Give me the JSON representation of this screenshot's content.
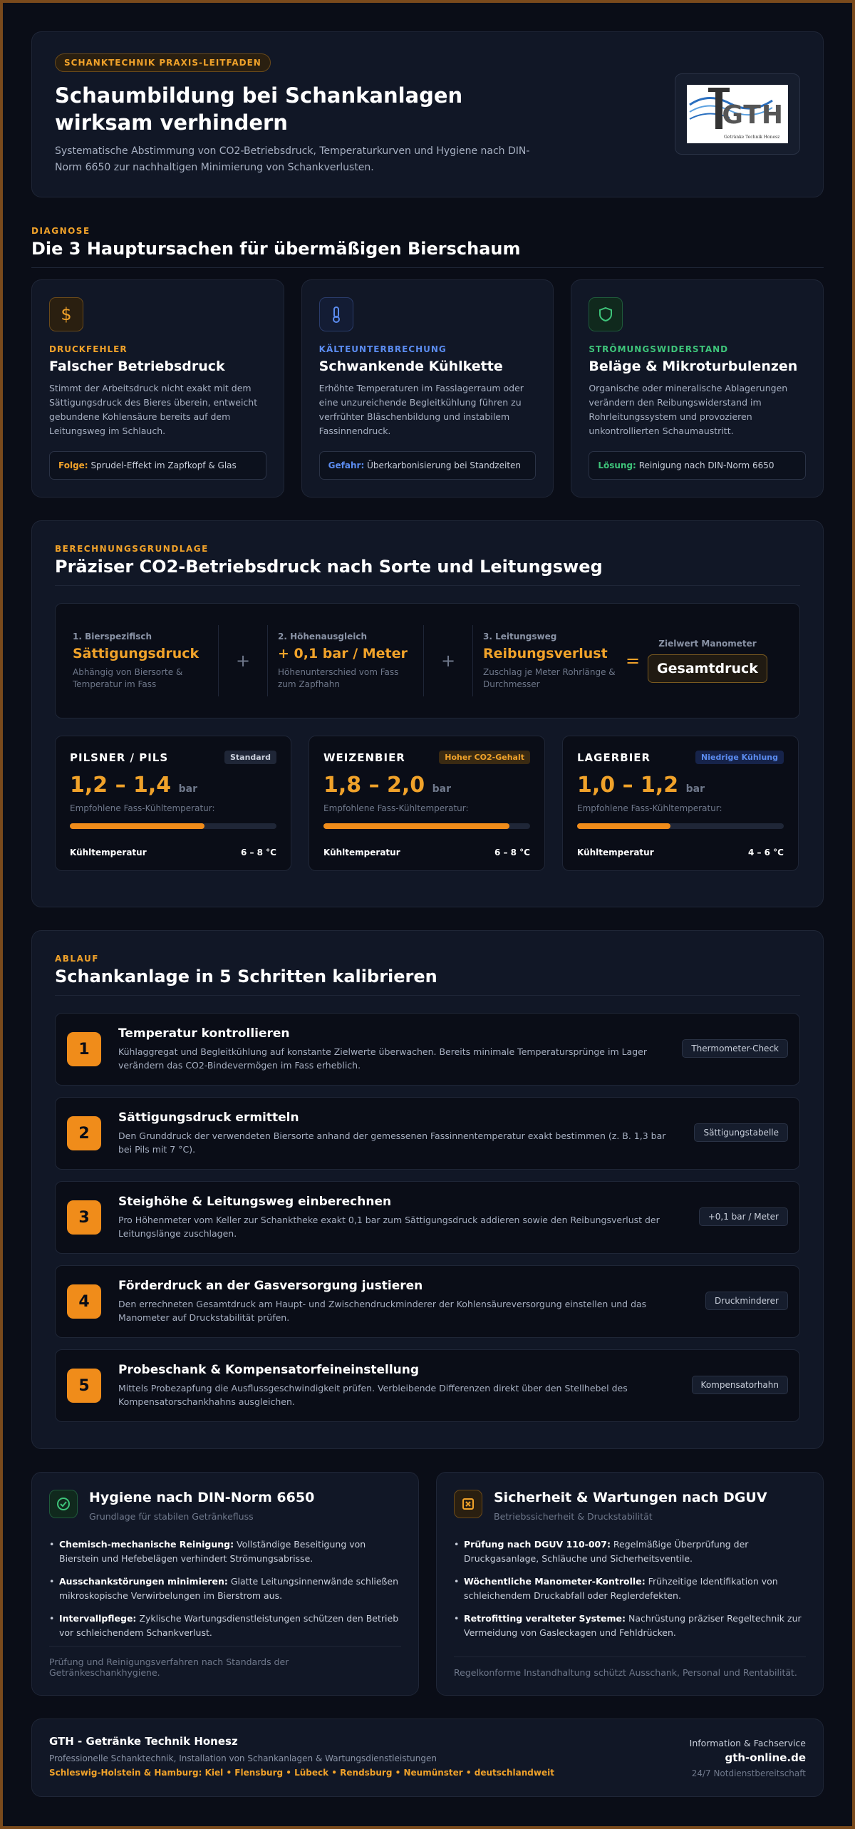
{
  "hero": {
    "pill": "SCHANKTECHNIK PRAXIS-LEITFADEN",
    "title": "Schaumbildung bei Schankanlagen wirksam verhindern",
    "desc": "Systematische Abstimmung von CO2-Betriebsdruck, Temperaturkurven und Hygiene nach DIN-Norm 6650 zur nachhaltigen Minimierung von Schankverlusten.",
    "logo_text": "GTH",
    "logo_sub": "Getränke Technik Honesz"
  },
  "diagnose": {
    "eyebrow": "DIAGNOSE",
    "title": "Die 3 Hauptursachen für übermäßigen Bierschaum",
    "cards": [
      {
        "tag": "DRUCKFEHLER",
        "title": "Falscher Betriebsdruck",
        "text": "Stimmt der Arbeitsdruck nicht exakt mit dem Sättigungsdruck des Bieres überein, entweicht gebundene Kohlensäure bereits auf dem Leitungsweg im Schlauch.",
        "note_key": "Folge:",
        "note": "Sprudel-Effekt im Zapfkopf & Glas",
        "color": "#f0a22a",
        "icon": "dollar-icon"
      },
      {
        "tag": "KÄLTEUNTERBRECHUNG",
        "title": "Schwankende Kühlkette",
        "text": "Erhöhte Temperaturen im Fasslagerraum oder eine unzureichende Begleitkühlung führen zu verfrühter Bläschenbildung und instabilem Fassinnendruck.",
        "note_key": "Gefahr:",
        "note": "Überkarbonisierung bei Standzeiten",
        "color": "#5b8cf0",
        "icon": "thermometer-icon"
      },
      {
        "tag": "STRÖMUNGSWIDERSTAND",
        "title": "Beläge & Mikroturbulenzen",
        "text": "Organische oder mineralische Ablagerungen verändern den Reibungswiderstand im Rohrleitungssystem und provozieren unkontrollierten Schaumaustritt.",
        "note_key": "Lösung:",
        "note": "Reinigung nach DIN-Norm 6650",
        "color": "#3ec47a",
        "icon": "shield-icon"
      }
    ]
  },
  "calc": {
    "eyebrow": "BERECHNUNGSGRUNDLAGE",
    "title": "Präziser CO2-Betriebsdruck nach Sorte und Leitungsweg",
    "parts": [
      {
        "n": "1. Bierspezifisch",
        "v": "Sättigungsdruck",
        "d": "Abhängig von Biersorte & Temperatur im Fass"
      },
      {
        "n": "2. Höhenausgleich",
        "v": "+ 0,1 bar / Meter",
        "d": "Höhenunterschied vom Fass zum Zapfhahn"
      },
      {
        "n": "3. Leitungsweg",
        "v": "Reibungsverlust",
        "d": "Zuschlag je Meter Rohrlänge & Durchmesser"
      }
    ],
    "op_plus": "+",
    "op_eq": "=",
    "result_label": "Zielwert Manometer",
    "result": "Gesamtdruck",
    "beers": [
      {
        "name": "PILSNER / PILS",
        "badge": "Standard",
        "badge_fg": "#c9cfdb",
        "badge_bg": "#1f2637",
        "value": "1,2 – 1,4",
        "unit": "bar",
        "label": "Empfohlene Fass-Kühltemperatur:",
        "fill": 0.65,
        "foot_l": "Kühltemperatur",
        "foot_r": "6 – 8 °C"
      },
      {
        "name": "WEIZENBIER",
        "badge": "Hoher CO2-Gehalt",
        "badge_fg": "#f0a22a",
        "badge_bg": "#3a2a12",
        "value": "1,8 – 2,0",
        "unit": "bar",
        "label": "Empfohlene Fass-Kühltemperatur:",
        "fill": 0.9,
        "foot_l": "Kühltemperatur",
        "foot_r": "6 – 8 °C"
      },
      {
        "name": "LAGERBIER",
        "badge": "Niedrige Kühlung",
        "badge_fg": "#5b8cf0",
        "badge_bg": "#16234a",
        "value": "1,0 – 1,2",
        "unit": "bar",
        "label": "Empfohlene Fass-Kühltemperatur:",
        "fill": 0.45,
        "foot_l": "Kühltemperatur",
        "foot_r": "4 – 6 °C"
      }
    ]
  },
  "steps": {
    "eyebrow": "ABLAUF",
    "title": "Schankanlage in 5 Schritten kalibrieren",
    "items": [
      {
        "n": "1",
        "t": "Temperatur kontrollieren",
        "d": "Kühlaggregat und Begleitkühlung auf konstante Zielwerte überwachen. Bereits minimale Temperatursprünge im Lager verändern das CO2-Bindevermögen im Fass erheblich.",
        "chip": "Thermometer-Check"
      },
      {
        "n": "2",
        "t": "Sättigungsdruck ermitteln",
        "d": "Den Grunddruck der verwendeten Biersorte anhand der gemessenen Fassinnentemperatur exakt bestimmen (z. B. 1,3 bar bei Pils mit 7 °C).",
        "chip": "Sättigungstabelle"
      },
      {
        "n": "3",
        "t": "Steighöhe & Leitungsweg einberechnen",
        "d": "Pro Höhenmeter vom Keller zur Schanktheke exakt 0,1 bar zum Sättigungsdruck addieren sowie den Reibungsverlust der Leitungslänge zuschlagen.",
        "chip": "+0,1 bar / Meter"
      },
      {
        "n": "4",
        "t": "Förderdruck an der Gasversorgung justieren",
        "d": "Den errechneten Gesamtdruck am Haupt- und Zwischendruckminderer der Kohlensäureversorgung einstellen und das Manometer auf Druckstabilität prüfen.",
        "chip": "Druckminderer"
      },
      {
        "n": "5",
        "t": "Probeschank & Kompensatorfeineinstellung",
        "d": "Mittels Probezapfung die Ausflussgeschwindigkeit prüfen. Verbleibende Differenzen direkt über den Stellhebel des Kompensatorschankhahns ausgleichen.",
        "chip": "Kompensatorhahn"
      }
    ]
  },
  "hygiene": {
    "title": "Hygiene nach DIN-Norm 6650",
    "sub": "Grundlage für stabilen Getränkefluss",
    "color": "#3ec47a",
    "items": [
      {
        "k": "Chemisch-mechanische Reinigung:",
        "v": " Vollständige Beseitigung von Bierstein und Hefebelägen verhindert Strömungsabrisse."
      },
      {
        "k": "Ausschankstörungen minimieren:",
        "v": " Glatte Leitungsinnenwände schließen mikroskopische Verwirbelungen im Bierstrom aus."
      },
      {
        "k": "Intervallpflege:",
        "v": " Zyklische Wartungsdienstleistungen schützen den Betrieb vor schleichendem Schankverlust."
      }
    ],
    "foot": "Prüfung und Reinigungsverfahren nach Standards der Getränkeschankhygiene."
  },
  "safety": {
    "title": "Sicherheit & Wartungen nach DGUV",
    "sub": "Betriebssicherheit & Druckstabilität",
    "color": "#f0a22a",
    "items": [
      {
        "k": "Prüfung nach DGUV 110-007:",
        "v": " Regelmäßige Überprüfung der Druckgasanlage, Schläuche und Sicherheitsventile."
      },
      {
        "k": "Wöchentliche Manometer-Kontrolle:",
        "v": " Frühzeitige Identifikation von schleichendem Druckabfall oder Reglerdefekten."
      },
      {
        "k": "Retrofitting veralteter Systeme:",
        "v": " Nachrüstung präziser Regeltechnik zur Vermeidung von Gasleckagen und Fehldrücken."
      }
    ],
    "foot": "Regelkonforme Instandhaltung schützt Ausschank, Personal und Rentabilität."
  },
  "footer": {
    "name": "GTH - Getränke Technik Honesz",
    "desc": "Professionelle Schanktechnik, Installation von Schankanlagen & Wartungsdienstleistungen",
    "regions": "Schleswig-Holstein & Hamburg: Kiel • Flensburg • Lübeck • Rendsburg • Neumünster • deutschlandweit",
    "info": "Information & Fachservice",
    "site": "gth-online.de",
    "service": "24/7 Notdienstbereitschaft"
  }
}
